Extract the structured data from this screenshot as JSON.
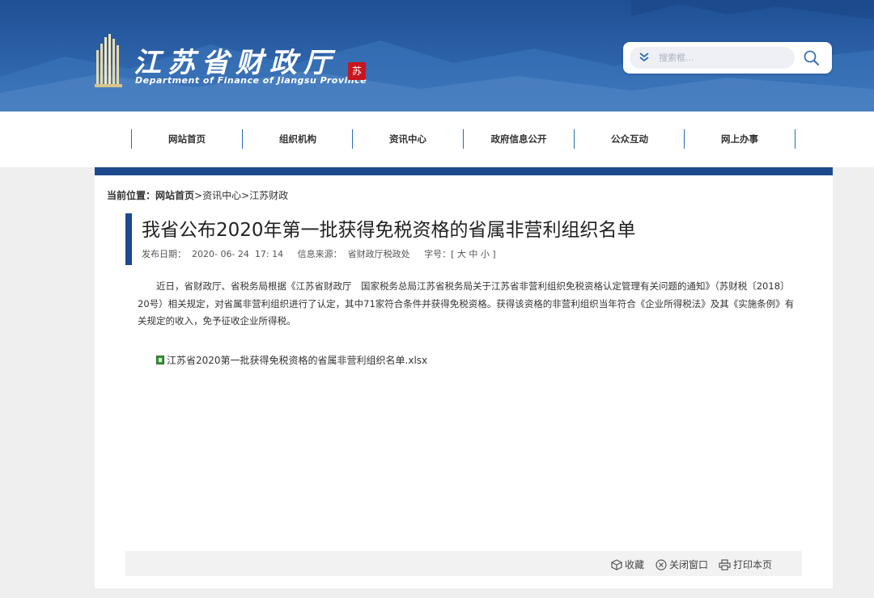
{
  "header": {
    "logo_cn": "江苏省财政厅",
    "logo_en": "Department of Finance of Jiangsu Province",
    "seal_text": "苏",
    "search_placeholder": "搜索框..."
  },
  "nav": {
    "items": [
      "网站首页",
      "组织机构",
      "资讯中心",
      "政府信息公开",
      "公众互动",
      "网上办事"
    ]
  },
  "breadcrumb": {
    "label": "当前位置：",
    "home": "网站首页",
    "sep1": ">",
    "level2": "资讯中心",
    "sep2": ">",
    "level3": "江苏财政"
  },
  "article": {
    "title": "我省公布2020年第一批获得免税资格的省属非营利组织名单",
    "date_label": "发布日期：",
    "date_value": "2020- 06- 24  17: 14",
    "source_label": "信息来源：",
    "source_value": "省财政厅税政处",
    "fontsize_label": "字号：[",
    "fontsize_large": "大",
    "fontsize_medium": "中",
    "fontsize_small": "小",
    "fontsize_close": "]",
    "body": "近日，省财政厅、省税务局根据《江苏省财政厅　国家税务总局江苏省税务局关于江苏省非营利组织免税资格认定管理有关问题的通知》（苏财税〔2018〕20号）相关规定，对省属非营利组织进行了认定，其中71家符合条件并获得免税资格。获得该资格的非营利组织当年符合《企业所得税法》及其《实施条例》有关规定的收入，免予征收企业所得税。",
    "attachment": "江苏省2020第一批获得免税资格的省属非营利组织名单.xlsx"
  },
  "footer_tools": {
    "favorite": "收藏",
    "close_window": "关闭窗口",
    "print": "打印本页"
  },
  "colors": {
    "brand_blue": "#1c4a8c",
    "nav_divider": "#2d6bb5",
    "seal_red": "#c8161e"
  }
}
